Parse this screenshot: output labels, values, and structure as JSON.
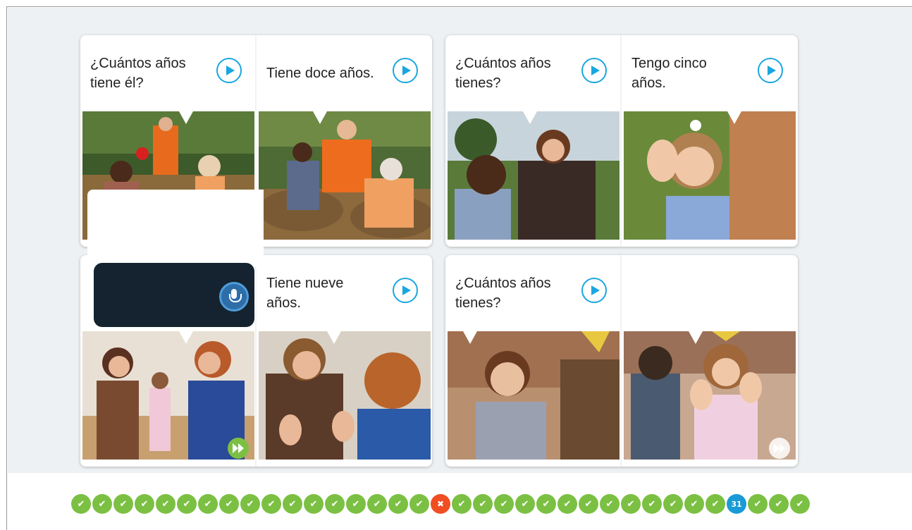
{
  "colors": {
    "accent": "#1aa6e0",
    "done": "#7bc043",
    "error": "#f04e23",
    "current": "#1a9ad6",
    "stage_bg": "#eef1f3",
    "recorder_bg": "#14232f"
  },
  "cards": [
    {
      "panels": [
        {
          "caption": "¿Cuántos años tiene él?",
          "play_icon": "play-circle-icon"
        },
        {
          "caption": "Tiene doce años.",
          "play_icon": "play-circle-icon"
        }
      ]
    },
    {
      "panels": [
        {
          "caption": "¿Cuántos años tienes?",
          "play_icon": "play-circle-icon"
        },
        {
          "caption": "Tengo cinco años.",
          "play_icon": "play-circle-icon"
        }
      ]
    },
    {
      "panels": [
        {
          "caption": "",
          "play_icon": ""
        },
        {
          "caption": "Tiene nueve años.",
          "play_icon": "play-circle-icon"
        }
      ],
      "skip_icon": "fast-forward-icon"
    },
    {
      "panels": [
        {
          "caption": "¿Cuántos años tienes?",
          "play_icon": "play-circle-icon"
        },
        {
          "caption": "",
          "play_icon": ""
        }
      ],
      "skip_icon": "fast-forward-icon"
    }
  ],
  "recorder": {
    "icon": "microphone-icon"
  },
  "progress": {
    "current_number": "31",
    "steps": [
      "done",
      "done",
      "done",
      "done",
      "done",
      "done",
      "done",
      "done",
      "done",
      "done",
      "done",
      "done",
      "done",
      "done",
      "done",
      "done",
      "done",
      "error",
      "done",
      "done",
      "done",
      "done",
      "done",
      "done",
      "done",
      "done",
      "done",
      "done",
      "done",
      "done",
      "done",
      "current",
      "done",
      "done",
      "done"
    ]
  }
}
